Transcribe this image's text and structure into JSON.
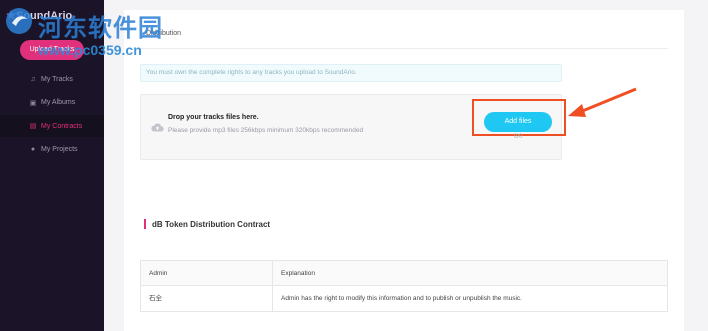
{
  "sidebar": {
    "brand": "SoundArio",
    "upload_label": "Upload Tracks",
    "items": [
      {
        "label": "My Tracks",
        "icon": "music-note-icon"
      },
      {
        "label": "My Albums",
        "icon": "album-icon"
      },
      {
        "label": "My Contracts",
        "icon": "contract-icon",
        "active": true
      },
      {
        "label": "My Projects",
        "icon": "user-icon"
      }
    ]
  },
  "card": {
    "title": "Distribution"
  },
  "notice": "You must own the complete rights to any tracks you upload to SoundArio.",
  "dropzone": {
    "title": "Drop your tracks files here.",
    "subtitle": "Please provide mp3 files 256kbps minimum 320kbps recommended",
    "button": "Add files",
    "mark": "0/0"
  },
  "section": {
    "title": "dB Token Distribution Contract"
  },
  "table": {
    "headers": [
      "Admin",
      "Explanation"
    ],
    "rows": [
      [
        "石全",
        "Admin has the right to modify this information and to publish or unpublish the music."
      ]
    ]
  },
  "watermark": {
    "line1": "河东软件园",
    "line2": "www.pc0359.cn"
  },
  "colors": {
    "accent": "#e1307c",
    "button": "#1ec8f2",
    "highlight": "#f04e23",
    "sidebar": "#1b1428"
  }
}
